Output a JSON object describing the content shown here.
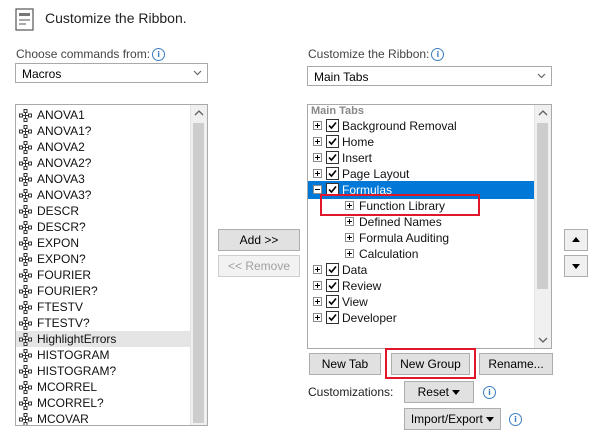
{
  "dialog": {
    "title": "Customize the Ribbon."
  },
  "left": {
    "label": "Choose commands from:",
    "dropdown_value": "Macros",
    "items": [
      "ANOVA1",
      "ANOVA1?",
      "ANOVA2",
      "ANOVA2?",
      "ANOVA3",
      "ANOVA3?",
      "DESCR",
      "DESCR?",
      "EXPON",
      "EXPON?",
      "FOURIER",
      "FOURIER?",
      "FTESTV",
      "FTESTV?",
      "HighlightErrors",
      "HISTOGRAM",
      "HISTOGRAM?",
      "MCORREL",
      "MCORREL?",
      "MCOVAR"
    ],
    "selected_item": "HighlightErrors"
  },
  "middle": {
    "add_label": "Add >>",
    "remove_label": "<< Remove"
  },
  "right": {
    "label": "Customize the Ribbon:",
    "dropdown_value": "Main Tabs",
    "header": "Main Tabs",
    "tree": [
      {
        "label": "Background Removal",
        "checked": true,
        "expander": "plus"
      },
      {
        "label": "Home",
        "checked": true,
        "expander": "plus"
      },
      {
        "label": "Insert",
        "checked": true,
        "expander": "plus"
      },
      {
        "label": "Page Layout",
        "checked": true,
        "expander": "plus"
      },
      {
        "label": "Formulas",
        "checked": true,
        "expander": "minus",
        "selected": true
      },
      {
        "label": "Function Library",
        "child": true
      },
      {
        "label": "Defined Names",
        "child": true
      },
      {
        "label": "Formula Auditing",
        "child": true
      },
      {
        "label": "Calculation",
        "child": true
      },
      {
        "label": "Data",
        "checked": true,
        "expander": "plus"
      },
      {
        "label": "Review",
        "checked": true,
        "expander": "plus"
      },
      {
        "label": "View",
        "checked": true,
        "expander": "plus"
      },
      {
        "label": "Developer",
        "checked": true,
        "expander": "plus"
      }
    ],
    "new_tab_label": "New Tab",
    "new_group_label": "New Group",
    "rename_label": "Rename...",
    "customizations_label": "Customizations:",
    "reset_label": "Reset",
    "import_export_label": "Import/Export"
  },
  "colors": {
    "selection": "#0078d7",
    "highlight_box": "#e0162b"
  }
}
